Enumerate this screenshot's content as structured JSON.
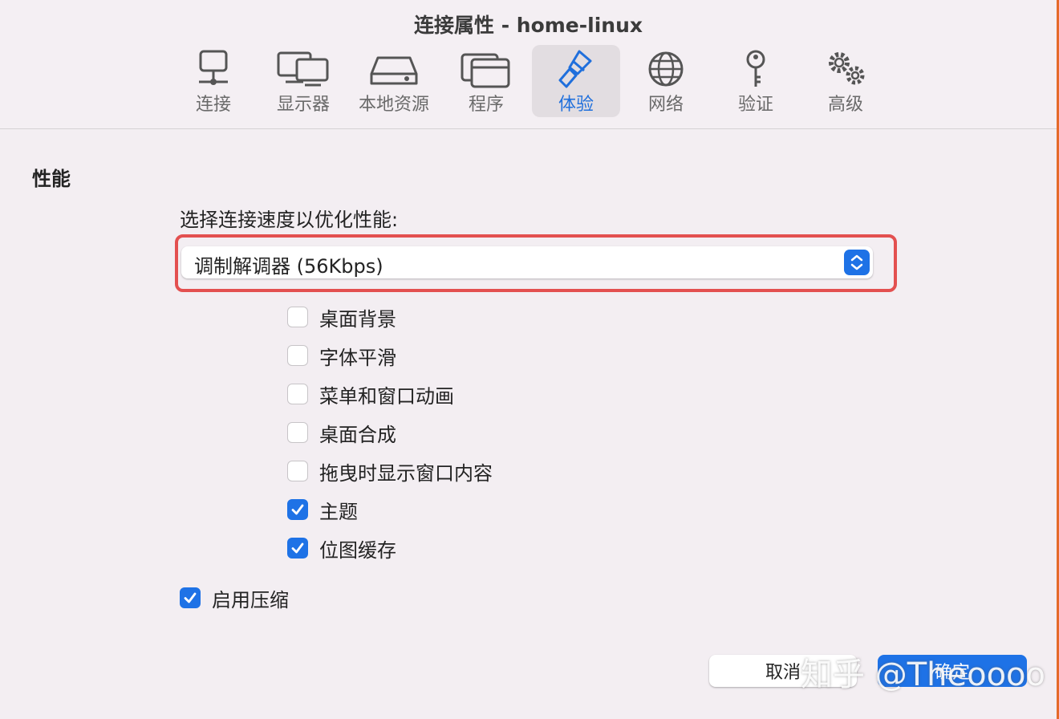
{
  "window": {
    "title": "连接属性 - home-linux"
  },
  "tabs": [
    {
      "label": "连接",
      "icon": "network-icon"
    },
    {
      "label": "显示器",
      "icon": "displays-icon"
    },
    {
      "label": "本地资源",
      "icon": "drive-icon"
    },
    {
      "label": "程序",
      "icon": "programs-icon"
    },
    {
      "label": "体验",
      "icon": "brush-icon",
      "active": true
    },
    {
      "label": "网络",
      "icon": "globe-icon"
    },
    {
      "label": "验证",
      "icon": "key-icon"
    },
    {
      "label": "高级",
      "icon": "gears-icon"
    }
  ],
  "performance": {
    "title": "性能",
    "speed_label": "选择连接速度以优化性能:",
    "speed_value": "调制解调器 (56Kbps)",
    "options": [
      {
        "label": "桌面背景",
        "checked": false
      },
      {
        "label": "字体平滑",
        "checked": false
      },
      {
        "label": "菜单和窗口动画",
        "checked": false
      },
      {
        "label": "桌面合成",
        "checked": false
      },
      {
        "label": "拖曳时显示窗口内容",
        "checked": false
      },
      {
        "label": "主题",
        "checked": true
      },
      {
        "label": "位图缓存",
        "checked": true
      }
    ],
    "compression": {
      "label": "启用压缩",
      "checked": true
    }
  },
  "buttons": {
    "cancel": "取消",
    "ok": "确定"
  },
  "watermark": "知乎 @Theoooo",
  "colors": {
    "accent": "#1e72e6",
    "highlight": "#e35050",
    "window_edge": "#e56a2a"
  }
}
